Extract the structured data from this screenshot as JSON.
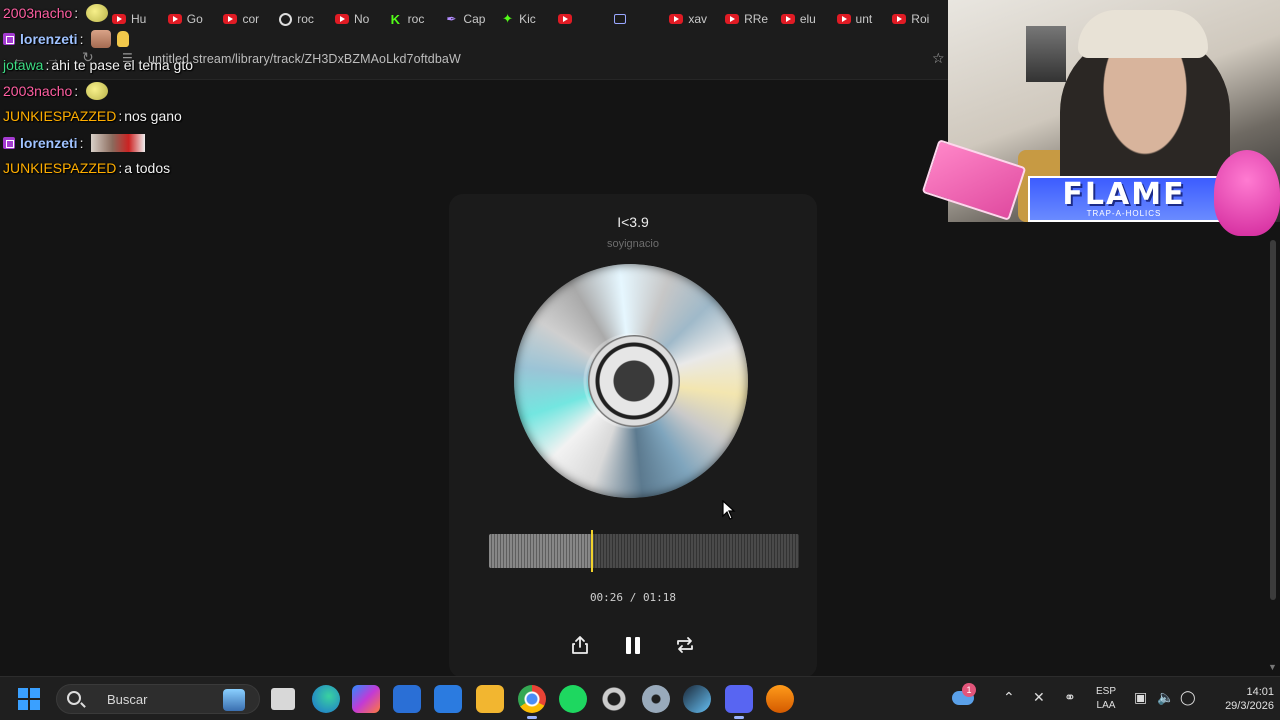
{
  "browser": {
    "tabs": [
      {
        "label": "Hu",
        "icon": "youtube-icon"
      },
      {
        "label": "Go",
        "icon": "youtube-icon"
      },
      {
        "label": "cor",
        "icon": "youtube-icon"
      },
      {
        "label": "roc",
        "icon": "google-icon"
      },
      {
        "label": "No",
        "icon": "youtube-icon"
      },
      {
        "label": "roc",
        "icon": "kick-k-icon"
      },
      {
        "label": "Cap",
        "icon": "feather-icon"
      },
      {
        "label": "Kic",
        "icon": "kick-icon"
      },
      {
        "label": "",
        "icon": "youtube-icon"
      },
      {
        "label": "",
        "icon": "window-icon"
      },
      {
        "label": "xav",
        "icon": "youtube-icon"
      },
      {
        "label": "RRe",
        "icon": "youtube-icon"
      },
      {
        "label": "elu",
        "icon": "youtube-icon"
      },
      {
        "label": "unt",
        "icon": "youtube-icon"
      },
      {
        "label": "Roi",
        "icon": "youtube-icon"
      }
    ],
    "url": "untitled.stream/library/track/ZH3DxBZMAoLkd7oftdbaW"
  },
  "chat": {
    "messages": [
      {
        "user": "2003nacho",
        "sep": ":",
        "text": "",
        "emote": "smiley",
        "color": "#ff5fa2"
      },
      {
        "user": "lorenzeti",
        "sep": ":",
        "text": "",
        "emote": "face-hand",
        "color": "#9fc2ff"
      },
      {
        "user": "jotawa",
        "sep": ":",
        "text": " ahi te pase el tema gto",
        "emote": "",
        "color": "#3ddc84"
      },
      {
        "user": "2003nacho",
        "sep": ":",
        "text": "",
        "emote": "smiley",
        "color": "#ff5fa2"
      },
      {
        "user": "JUNKIESPAZZED",
        "sep": ":",
        "text": " nos gano",
        "emote": "",
        "color": "#ffae00"
      },
      {
        "user": "lorenzeti",
        "sep": ":",
        "text": "",
        "emote": "image",
        "color": "#9fc2ff"
      },
      {
        "user": "JUNKIESPAZZED",
        "sep": ":",
        "text": " a todos",
        "emote": "",
        "color": "#ffae00"
      }
    ]
  },
  "player": {
    "title": "I<3.9",
    "artist": "soyignacio",
    "elapsed": "00:26",
    "separator": "/",
    "duration": "01:18",
    "progress": 0.333
  },
  "overlay": {
    "banner_text": "FLAME",
    "banner_sub": "TRAP-A-HOLICS"
  },
  "taskbar": {
    "search_label": "Buscar",
    "tray_badge": "1",
    "lang_top": "ESP",
    "lang_bottom": "LAA",
    "time": "14:01",
    "date": "29/3/2026"
  }
}
